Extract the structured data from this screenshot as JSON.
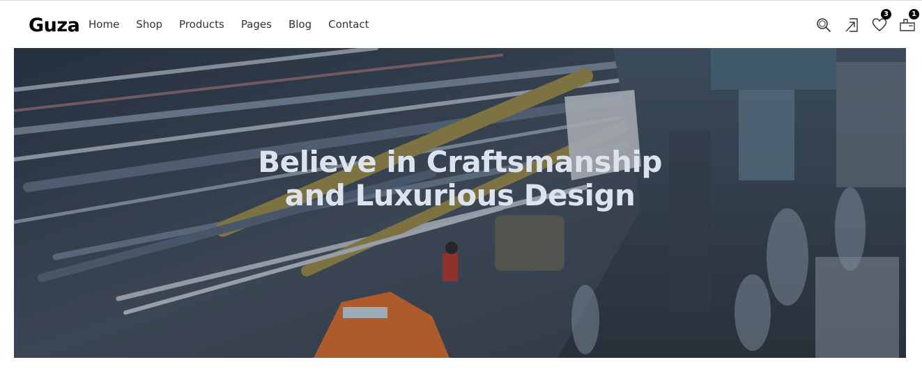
{
  "brand": {
    "logo_text": "Guza"
  },
  "nav": {
    "items": [
      {
        "label": "Home"
      },
      {
        "label": "Shop"
      },
      {
        "label": "Products"
      },
      {
        "label": "Pages"
      },
      {
        "label": "Blog"
      },
      {
        "label": "Contact"
      }
    ]
  },
  "actions": {
    "search_icon": "search-icon",
    "login_icon": "sign-in-icon",
    "wishlist": {
      "icon": "heart-icon",
      "count": "3"
    },
    "cart": {
      "icon": "bag-icon",
      "count": "1"
    }
  },
  "hero": {
    "title_line_1": "Believe in Craftsmanship",
    "title_line_2": "and Luxurious Design",
    "image": "night-city-street-market-long-exposure"
  },
  "colors": {
    "text": "#333333",
    "badge_bg": "#000000",
    "hero_title": "#dde3ec",
    "taxi": "#e8742a"
  }
}
